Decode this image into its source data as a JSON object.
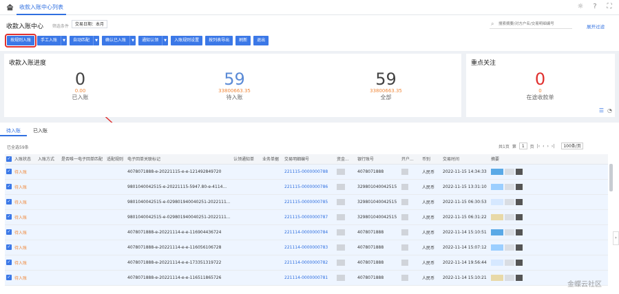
{
  "topbar": {
    "tab": "收款入账中心列表"
  },
  "header": {
    "title": "收款入账中心",
    "filter_label": "筛选条件",
    "filter_chip": "交易日期：本月",
    "search_placeholder": "搜索摘要/对方户名/交易明细编号",
    "expand_filter": "展开过滤"
  },
  "toolbar": {
    "buttons": [
      {
        "label": "按规则入账",
        "split": false
      },
      {
        "label": "手工入账",
        "split": true
      },
      {
        "label": "自动匹配",
        "split": true
      },
      {
        "label": "确认已入账",
        "split": true
      },
      {
        "label": "通知认领",
        "split": true
      },
      {
        "label": "入账规则设置",
        "split": false
      },
      {
        "label": "按列表导出",
        "split": false
      },
      {
        "label": "刷新",
        "split": false
      },
      {
        "label": "退出",
        "split": false
      }
    ]
  },
  "progress": {
    "title": "收款入账进度",
    "stats": [
      {
        "num": "0",
        "amt": "0.00",
        "label": "已入账",
        "color": "#444444"
      },
      {
        "num": "59",
        "amt": "33800663.35",
        "label": "待入账",
        "color": "#5b8bd6"
      },
      {
        "num": "59",
        "amt": "33800663.35",
        "label": "全部",
        "color": "#444444"
      }
    ]
  },
  "focus": {
    "title": "重点关注",
    "num": "0",
    "amt": "0",
    "label": "在途收款单"
  },
  "list": {
    "tabs": [
      "待入账",
      "已入账"
    ],
    "selected_info": "已全选59条",
    "pager": {
      "total": "共1页",
      "page_prefix": "第",
      "page": "1",
      "page_suffix": "页",
      "page_size": "100条/页"
    },
    "columns": [
      "入账状态",
      "入账方式",
      "是否唯一电子回单匹配",
      "适配规则",
      "电子回单关联标记",
      "认领通知单",
      "业务单据",
      "交易明细编号",
      "资金...",
      "银行账号",
      "开户...",
      "币别",
      "交易时间",
      "摘要"
    ],
    "rows": [
      {
        "status": "待入账",
        "mark": "4078071888-e-20221115-e-e-121492849720",
        "txn": "221115-0000000788",
        "account": "4078071888",
        "currency": "人民币",
        "time": "2022-11-15 14:34:33"
      },
      {
        "status": "待入账",
        "mark": "9801040042515-e-20221115-5947.80-e-4114...",
        "txn": "221115-0000000786",
        "account": "329801040042515",
        "currency": "人民币",
        "time": "2022-11-15 13:31:10"
      },
      {
        "status": "待入账",
        "mark": "9801040042515-e-029801940040251-2022111...",
        "txn": "221115-0000000785",
        "account": "329801040042515",
        "currency": "人民币",
        "time": "2022-11-15 06:30:53"
      },
      {
        "status": "待入账",
        "mark": "9801040042515-e-029801940040251-2022111...",
        "txn": "221115-0000000787",
        "account": "329801040042515",
        "currency": "人民币",
        "time": "2022-11-15 06:31:22"
      },
      {
        "status": "待入账",
        "mark": "4078071888-e-20221114-e-e-116904436724",
        "txn": "221114-0000000784",
        "account": "4078071888",
        "currency": "人民币",
        "time": "2022-11-14 15:10:51"
      },
      {
        "status": "待入账",
        "mark": "4078071888-e-20221114-e-e-116056106728",
        "txn": "221114-0000000783",
        "account": "4078071888",
        "currency": "人民币",
        "time": "2022-11-14 15:07:12"
      },
      {
        "status": "待入账",
        "mark": "4078071888-e-20221114-e-e-173351319722",
        "txn": "221114-0000000782",
        "account": "4078071888",
        "currency": "人民币",
        "time": "2022-11-14 19:56:44"
      },
      {
        "status": "待入账",
        "mark": "4078071888-e-20221114-e-e-116511865726",
        "txn": "221114-0000000781",
        "account": "4078071888",
        "currency": "人民币",
        "time": "2022-11-14 15:10:21"
      }
    ]
  },
  "watermark": "金蝶云社区"
}
